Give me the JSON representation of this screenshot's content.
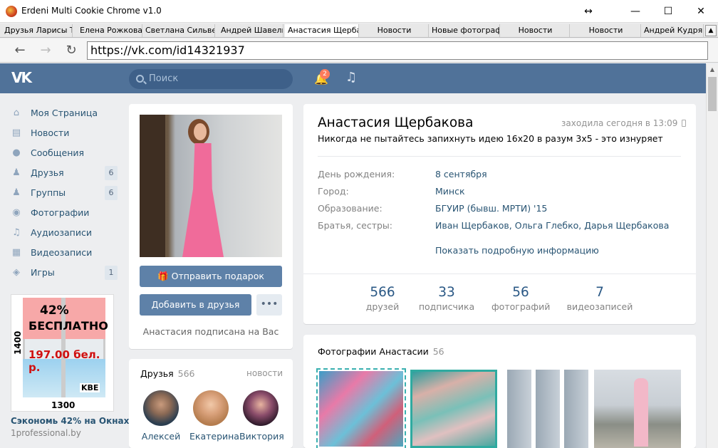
{
  "window": {
    "title": "Erdeni Multi Cookie Chrome v1.0",
    "controls": {
      "resize": "↔",
      "minimize": "—",
      "maximize": "☐",
      "close": "✕"
    }
  },
  "tabs": [
    {
      "label": "Друзья Ларисы Том"
    },
    {
      "label": "Елена Рожкова"
    },
    {
      "label": "Светлана Сильвер"
    },
    {
      "label": "Андрей Шавель"
    },
    {
      "label": "Анастасия Щербакова"
    },
    {
      "label": "Новости"
    },
    {
      "label": "Новые фотографии"
    },
    {
      "label": "Новости"
    },
    {
      "label": "Новости"
    },
    {
      "label": "Андрей Кудрявц"
    }
  ],
  "navbar": {
    "url": "https://vk.com/id14321937"
  },
  "vk_header": {
    "logo": "VK",
    "search_placeholder": "Поиск",
    "notifications_count": "2"
  },
  "left_nav": [
    {
      "label": "Моя Страница",
      "icon": "home-icon",
      "count": ""
    },
    {
      "label": "Новости",
      "icon": "news-icon",
      "count": ""
    },
    {
      "label": "Сообщения",
      "icon": "messages-icon",
      "count": ""
    },
    {
      "label": "Друзья",
      "icon": "friends-icon",
      "count": "6"
    },
    {
      "label": "Группы",
      "icon": "groups-icon",
      "count": "6"
    },
    {
      "label": "Фотографии",
      "icon": "camera-icon",
      "count": ""
    },
    {
      "label": "Аудиозаписи",
      "icon": "music-icon",
      "count": ""
    },
    {
      "label": "Видеозаписи",
      "icon": "video-icon",
      "count": ""
    },
    {
      "label": "Игры",
      "icon": "gamepad-icon",
      "count": "1"
    }
  ],
  "ad": {
    "line1": "42%",
    "line2": "БЕСПЛАТНО",
    "price": "197.00 бел. р.",
    "height": "1400",
    "width": "1300",
    "brand": "KBE",
    "caption": "Сэкономь 42% на Окнах!",
    "domain": "1professional.by"
  },
  "profile": {
    "gift_button": "Отправить подарок",
    "add_friend_button": "Добавить в друзья",
    "more_button": "•••",
    "subscribed_text": "Анастасия подписана на Вас",
    "name": "Анастасия Щербакова",
    "online": "заходила сегодня в 13:09",
    "status": "Никогда не пытайтесь запихнуть идею 16х20 в разум 3х5 - это изнуряет",
    "info": [
      {
        "key": "День рождения:",
        "value": "8 сентября"
      },
      {
        "key": "Город:",
        "value": "Минск"
      },
      {
        "key": "Образование:",
        "value": "БГУИР (бывш. МРТИ) '15"
      },
      {
        "key": "Братья, сестры:",
        "value": "Иван Щербаков, Ольга Глебко, Дарья Щербакова"
      }
    ],
    "more_info": "Показать подробную информацию",
    "stats": [
      {
        "num": "566",
        "label": "друзей"
      },
      {
        "num": "33",
        "label": "подписчика"
      },
      {
        "num": "56",
        "label": "фотографий"
      },
      {
        "num": "7",
        "label": "видеозаписей"
      }
    ]
  },
  "friends": {
    "title": "Друзья",
    "count": "566",
    "link": "новости",
    "items": [
      {
        "name": "Алексей"
      },
      {
        "name": "Екатерина"
      },
      {
        "name": "Виктория"
      }
    ]
  },
  "photos": {
    "title": "Фотографии Анастасии",
    "count": "56"
  }
}
